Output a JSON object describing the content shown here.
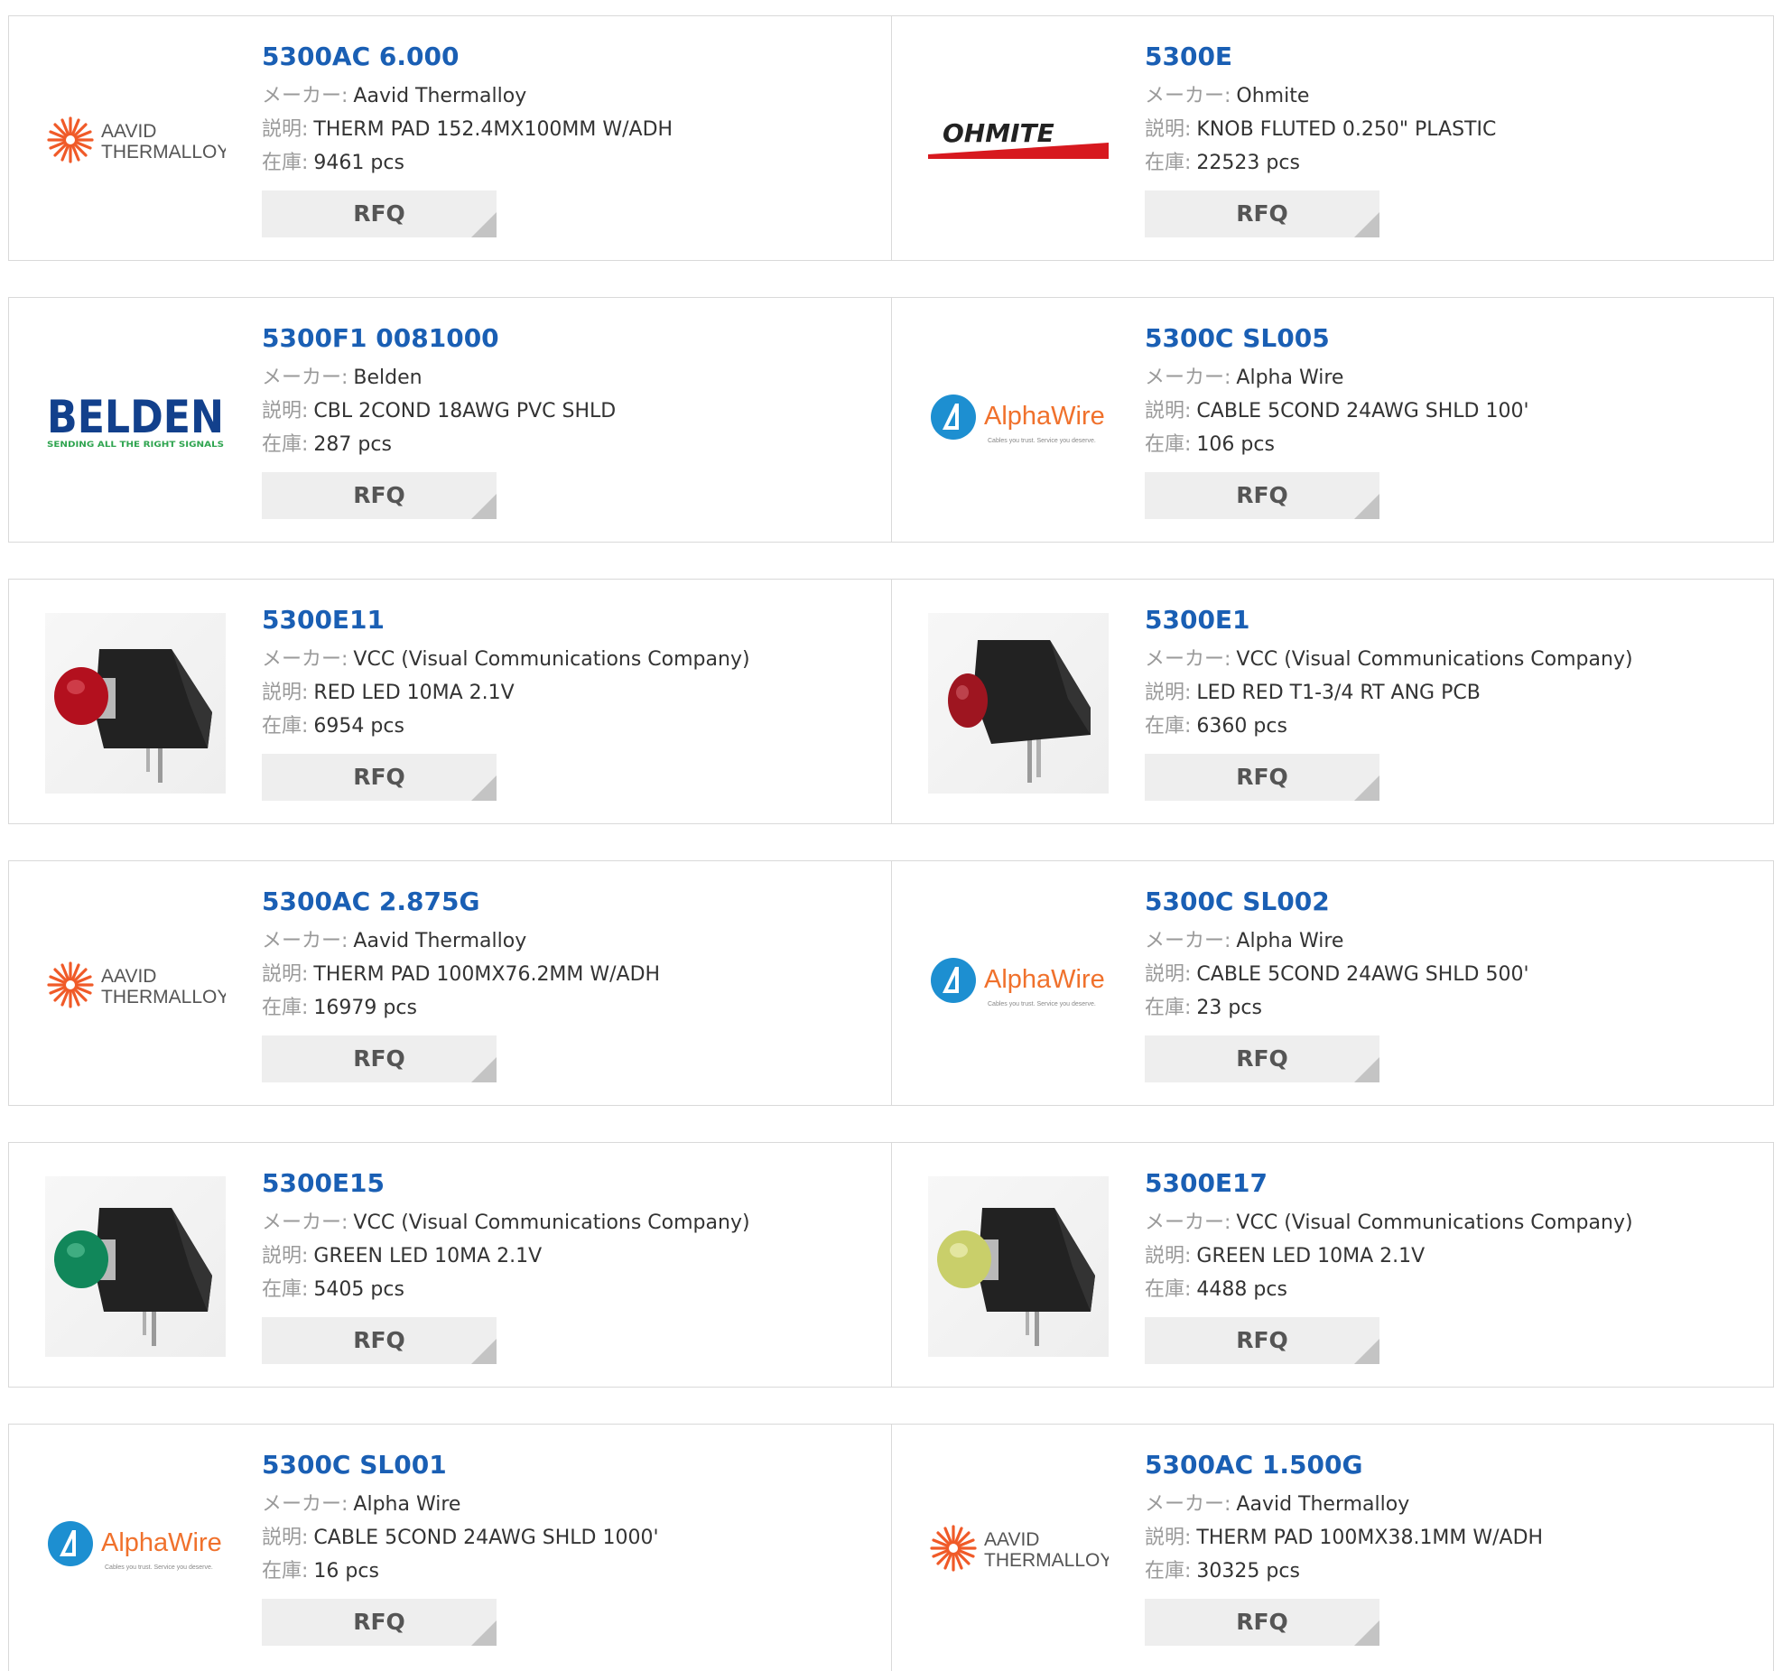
{
  "labels": {
    "manufacturer": "メーカー:",
    "description": "説明:",
    "stock": "在庫:",
    "rfq": "RFQ"
  },
  "products": [
    {
      "part": "5300AC 6.000",
      "manufacturer": "Aavid Thermalloy",
      "description": "THERM PAD 152.4MX100MM W/ADH",
      "stock": "9461 pcs",
      "image": "aavid-thermalloy-logo"
    },
    {
      "part": "5300E",
      "manufacturer": "Ohmite",
      "description": "KNOB FLUTED 0.250\" PLASTIC",
      "stock": "22523 pcs",
      "image": "ohmite-logo"
    },
    {
      "part": "5300F1 0081000",
      "manufacturer": "Belden",
      "description": "CBL 2COND 18AWG PVC SHLD",
      "stock": "287 pcs",
      "image": "belden-logo"
    },
    {
      "part": "5300C SL005",
      "manufacturer": "Alpha Wire",
      "description": "CABLE 5COND 24AWG SHLD 100'",
      "stock": "106 pcs",
      "image": "alphawire-logo"
    },
    {
      "part": "5300E11",
      "manufacturer": "VCC (Visual Communications Company)",
      "description": "RED LED 10MA 2.1V",
      "stock": "6954 pcs",
      "image": "red-led-photo"
    },
    {
      "part": "5300E1",
      "manufacturer": "VCC (Visual Communications Company)",
      "description": "LED RED T1-3/4 RT ANG PCB",
      "stock": "6360 pcs",
      "image": "red-led-photo"
    },
    {
      "part": "5300AC 2.875G",
      "manufacturer": "Aavid Thermalloy",
      "description": "THERM PAD 100MX76.2MM W/ADH",
      "stock": "16979 pcs",
      "image": "aavid-thermalloy-logo"
    },
    {
      "part": "5300C SL002",
      "manufacturer": "Alpha Wire",
      "description": "CABLE 5COND 24AWG SHLD 500'",
      "stock": "23 pcs",
      "image": "alphawire-logo"
    },
    {
      "part": "5300E15",
      "manufacturer": "VCC (Visual Communications Company)",
      "description": "GREEN LED 10MA 2.1V",
      "stock": "5405 pcs",
      "image": "green-led-photo"
    },
    {
      "part": "5300E17",
      "manufacturer": "VCC (Visual Communications Company)",
      "description": "GREEN LED 10MA 2.1V",
      "stock": "4488 pcs",
      "image": "yellow-green-led-photo"
    },
    {
      "part": "5300C SL001",
      "manufacturer": "Alpha Wire",
      "description": "CABLE 5COND 24AWG SHLD 1000'",
      "stock": "16 pcs",
      "image": "alphawire-logo"
    },
    {
      "part": "5300AC 1.500G",
      "manufacturer": "Aavid Thermalloy",
      "description": "THERM PAD 100MX38.1MM W/ADH",
      "stock": "30325 pcs",
      "image": "aavid-thermalloy-logo"
    }
  ],
  "logos": {
    "aavid": {
      "line1": "AAVID",
      "line2": "THERMALLOY"
    },
    "ohmite": {
      "text": "OHMITE"
    },
    "belden": {
      "text": "BELDEN",
      "tagline": "SENDING ALL THE RIGHT SIGNALS"
    },
    "alphawire": {
      "text": "AlphaWire",
      "tagline": "Cables you trust. Service you deserve."
    }
  },
  "colors": {
    "part_link": "#1a5fb4",
    "label": "#9a9a9a",
    "value": "#333333",
    "rfq_bg": "#eeeeee",
    "border": "#d9d9d9",
    "aavid_orange": "#f05a28",
    "ohmite_red": "#d7191f",
    "belden_blue": "#12408c",
    "belden_green": "#2ea44f",
    "alphawire_blue": "#1d8fd1",
    "alphawire_orange": "#f0712c",
    "led_red": "#b3101e",
    "led_green": "#11875a",
    "led_yellowgreen": "#c9cf6a"
  }
}
